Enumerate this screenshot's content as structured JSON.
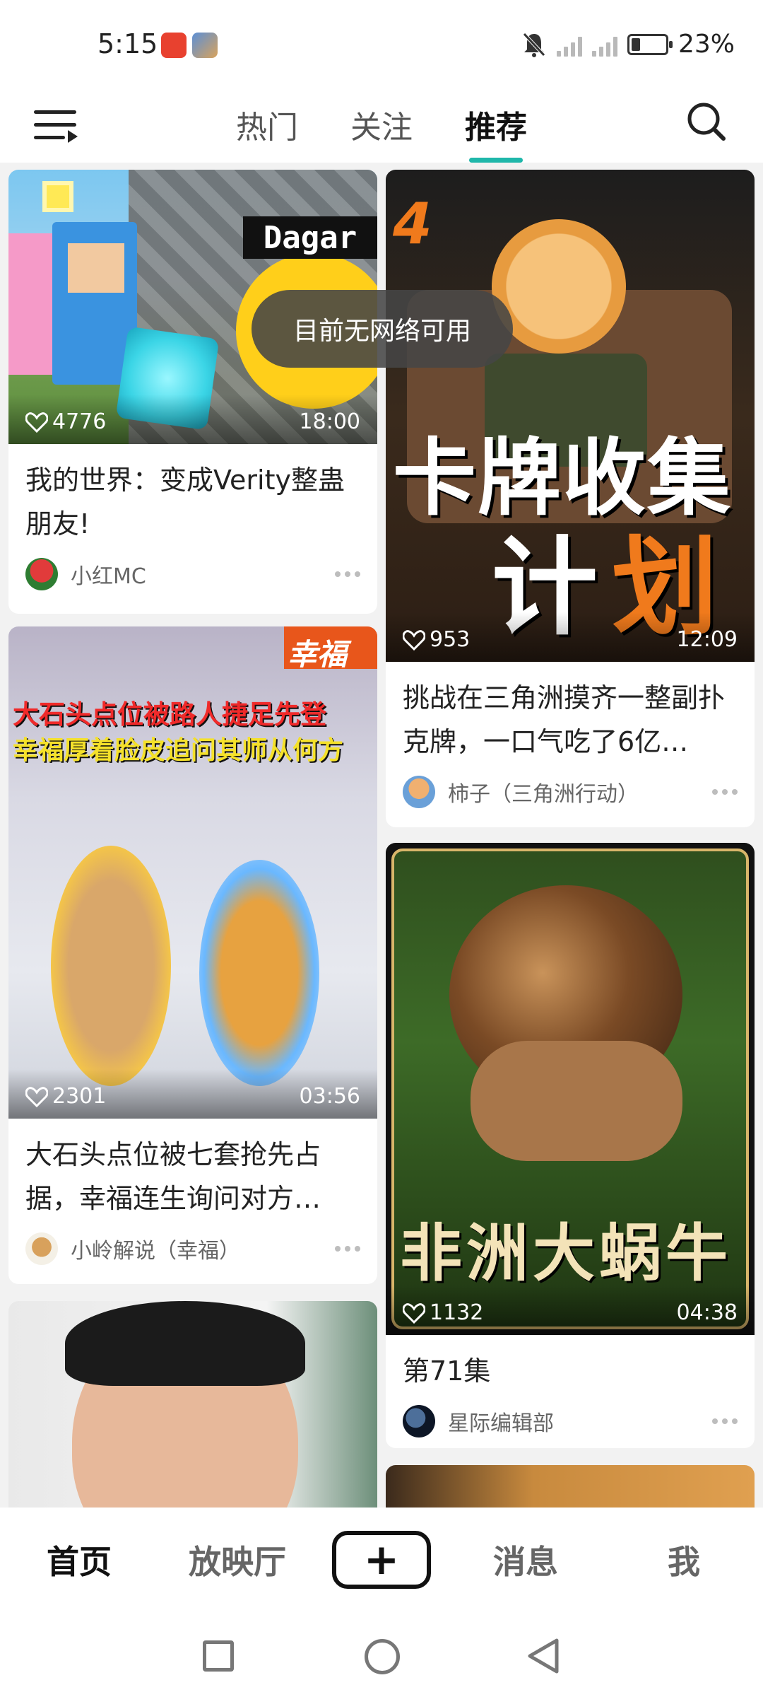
{
  "status_bar": {
    "time": "5:15",
    "battery": "23%",
    "battery_level": 0.23
  },
  "top_nav": {
    "tabs": [
      {
        "label": "热门"
      },
      {
        "label": "关注"
      },
      {
        "label": "推荐"
      }
    ],
    "active_tab": "推荐"
  },
  "toast": "目前无网络可用",
  "feed": {
    "cards": [
      {
        "title": "我的世界：变成Verity整蛊朋友!",
        "likes": "4776",
        "duration": "18:00",
        "author": "小红MC",
        "thumb_text": "Dagar"
      },
      {
        "title": "挑战在三角洲摸齐一整副扑克牌，一口气吃了6亿…",
        "likes": "953",
        "duration": "12:09",
        "author": "柿子（三角洲行动）",
        "thumb_text_line1": "卡牌收集",
        "thumb_text_line2": "计",
        "thumb_text_line2b": "划",
        "thumb_badge": "4"
      },
      {
        "title": "大石头点位被七套抢先占据，幸福连生询问对方…",
        "likes": "2301",
        "duration": "03:56",
        "author": "小岭解说（幸福）",
        "thumb_tag": "幸福",
        "thumb_headline1": "大石头点位被路人捷足先登",
        "thumb_headline2": "幸福厚着脸皮追问其师从何方"
      },
      {
        "title": "第71集",
        "likes": "1132",
        "duration": "04:38",
        "author": "星际编辑部",
        "thumb_text": "非洲大蜗牛"
      },
      {
        "title": "",
        "likes": "",
        "duration": "",
        "author": ""
      },
      {
        "title": "",
        "likes": "",
        "duration": "",
        "author": ""
      }
    ]
  },
  "bottom_nav": {
    "home": "首页",
    "theater": "放映厅",
    "add": "+",
    "messages": "消息",
    "me": "我"
  },
  "colors": {
    "accent": "#1fb7aa"
  }
}
